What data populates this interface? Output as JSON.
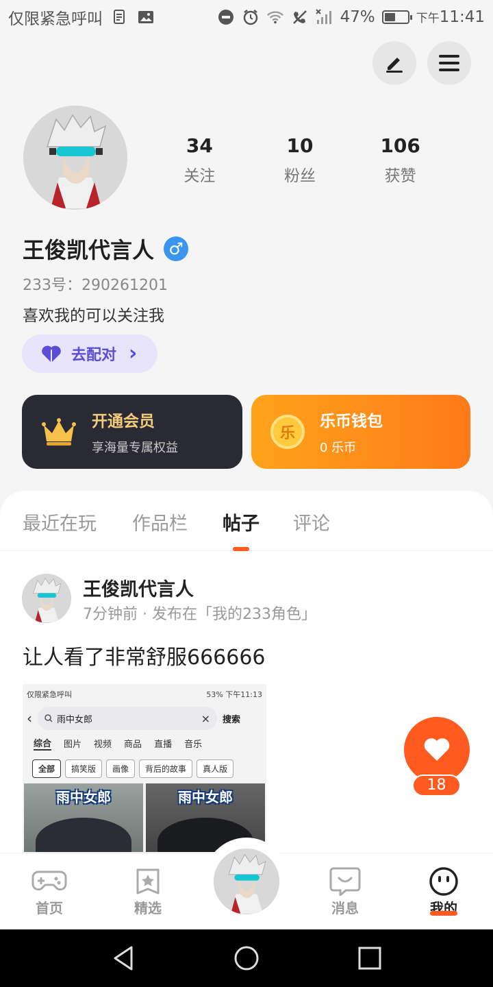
{
  "status_bar": {
    "carrier": "仅限紧急呼叫",
    "battery_text": "47%",
    "battery_level": 0.47,
    "ampm": "下午",
    "time": "11:41"
  },
  "header": {
    "edit_icon": "pencil-icon",
    "menu_icon": "menu-icon"
  },
  "profile": {
    "stats": [
      {
        "value": "34",
        "label": "关注"
      },
      {
        "value": "10",
        "label": "粉丝"
      },
      {
        "value": "106",
        "label": "获赞"
      }
    ],
    "name": "王俊凯代言人",
    "gender_symbol": "♂",
    "id_label": "233号：",
    "id_value": "290261201",
    "bio": "喜欢我的可以关注我",
    "match_label": "去配对",
    "match_chevron": "›"
  },
  "cards": {
    "vip": {
      "title": "开通会员",
      "subtitle": "享海量专属权益"
    },
    "coin": {
      "title": "乐币钱包",
      "subtitle": "0 乐币",
      "coin_glyph": "乐"
    }
  },
  "tabs": [
    {
      "label": "最近在玩",
      "active": false
    },
    {
      "label": "作品栏",
      "active": false
    },
    {
      "label": "帖子",
      "active": true
    },
    {
      "label": "评论",
      "active": false
    }
  ],
  "post": {
    "author": "王俊凯代言人",
    "meta": "7分钟前 · 发布在「我的233角色」",
    "text": "让人看了非常舒服666666",
    "like_count": "18",
    "screenshot": {
      "status_left": "仅限紧急呼叫",
      "status_right": "53%  下午11:13",
      "search_query": "雨中女郎",
      "search_button": "搜索",
      "categories": [
        "综合",
        "图片",
        "视频",
        "商品",
        "直播",
        "音乐"
      ],
      "tags": [
        "全部",
        "搞笑版",
        "画像",
        "背后的故事",
        "真人版"
      ],
      "img1_caption": "雨中女郎",
      "img2_caption": "雨中女郎"
    }
  },
  "bottom_nav": [
    {
      "label": "首页",
      "icon": "gamepad-icon",
      "active": false
    },
    {
      "label": "精选",
      "icon": "star-icon",
      "active": false
    },
    {
      "label": "消息",
      "icon": "message-icon",
      "active": false
    },
    {
      "label": "我的",
      "icon": "face-icon",
      "active": true
    }
  ],
  "colors": {
    "accent": "#ff5a1f",
    "vip_card": "#2a2a35",
    "coin_card": "#ff8c1a",
    "match_bg": "#e7e4fb",
    "gender": "#3a95f0"
  }
}
